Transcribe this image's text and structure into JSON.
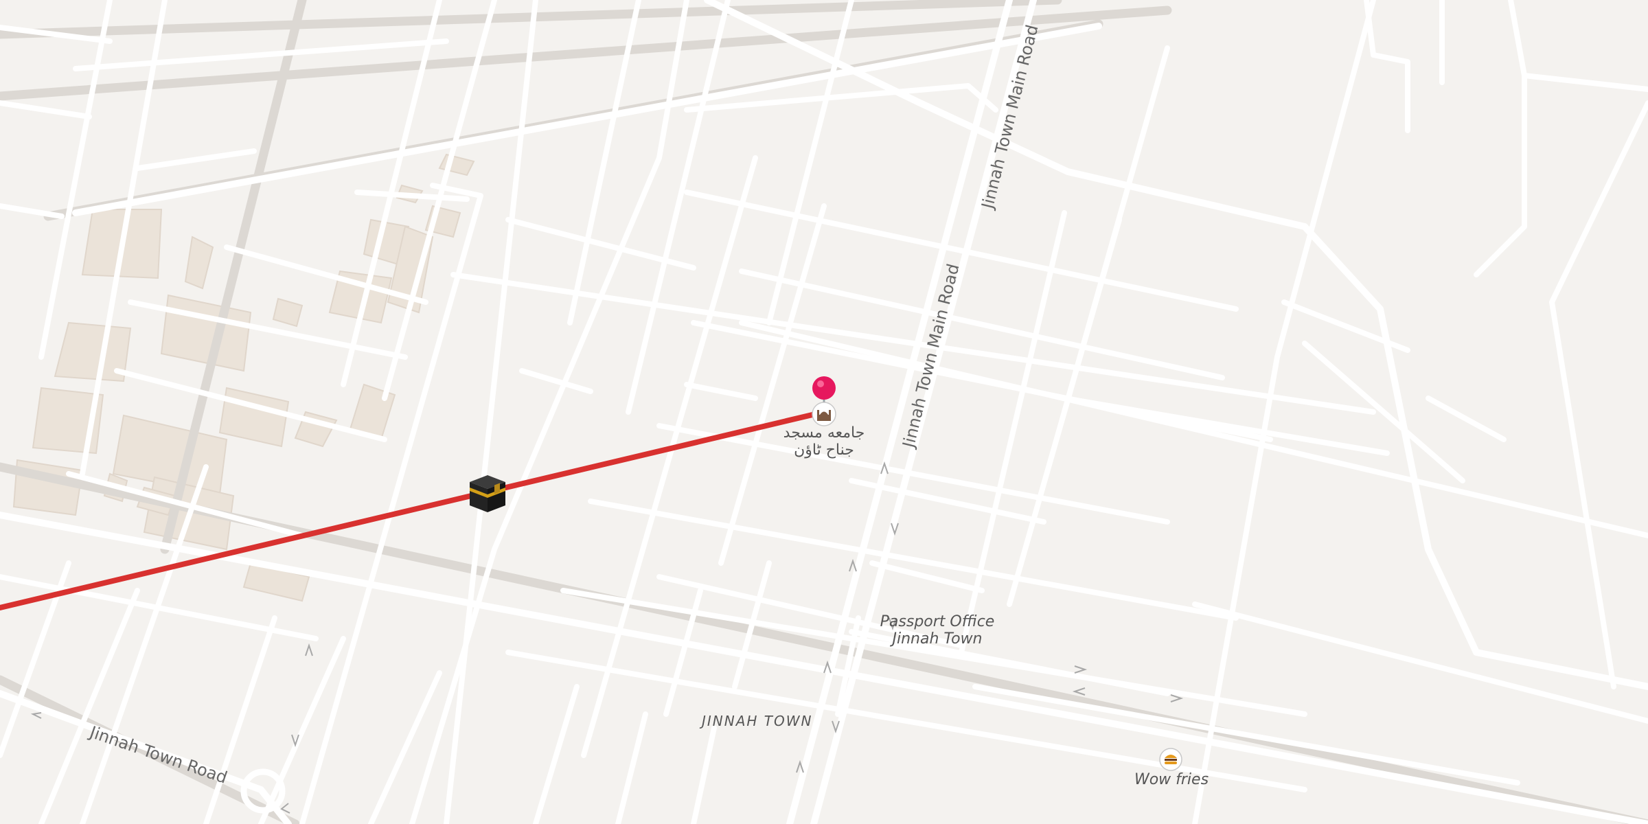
{
  "map": {
    "roads": [
      {
        "name": "Jinnah Town Main Road",
        "labels": [
          "Jinnah Town Main Road",
          "Jinnah Town Main Road"
        ]
      },
      {
        "name": "Jinnah Town Road",
        "labels": [
          "Jinnah Town Road"
        ]
      }
    ],
    "area_label": "JINNAH TOWN",
    "pois": [
      {
        "name": "جامعه مسجد جناح ٹاؤن",
        "line1": "جامعه مسجد",
        "line2": "جناح ٹاؤن",
        "icon": "mosque-icon",
        "marker": "pin-icon"
      },
      {
        "name": "Passport Office Jinnah Town",
        "line1": "Passport Office",
        "line2": "Jinnah Town"
      },
      {
        "name": "Wow fries",
        "line1": "Wow fries",
        "icon": "burger-icon"
      }
    ],
    "qibla": {
      "icon": "kaaba-icon",
      "line_color": "#d32f2f"
    },
    "colors": {
      "background": "#f4f2ef",
      "road": "#ffffff",
      "road_edge": "#dedad6",
      "building": "#ece4da",
      "pin": "#e91e63"
    }
  }
}
